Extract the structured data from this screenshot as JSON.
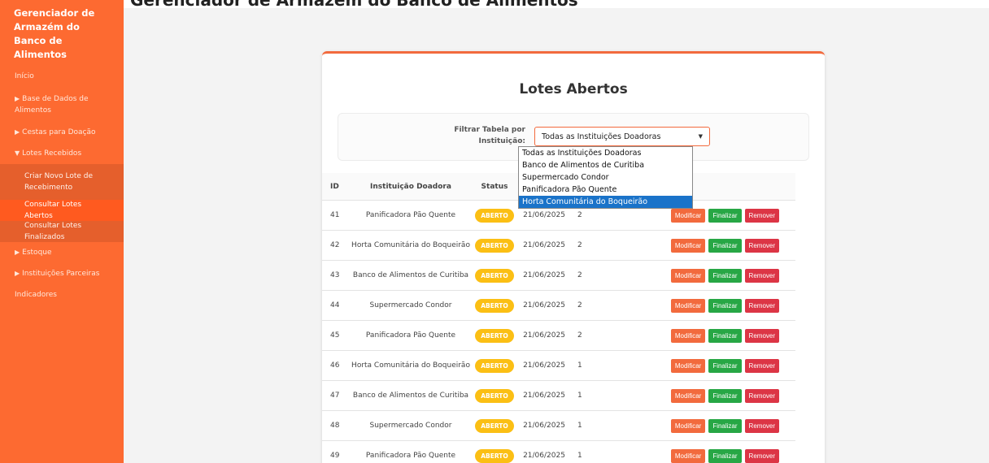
{
  "header": {
    "title": "Gerenciador de Armazém do Banco de Alimentos"
  },
  "sidebar": {
    "brand": "Gerenciador de Armazém do Banco de Alimentos",
    "items": [
      {
        "label": "Início"
      },
      {
        "label": "Base de Dados de Alimentos",
        "arrow": "▶"
      },
      {
        "label": "Cestas para Doação",
        "arrow": "▶"
      },
      {
        "label": "Lotes Recebidos",
        "arrow": "▼"
      }
    ],
    "sub_items": [
      {
        "label": "Criar Novo Lote de Recebimento"
      },
      {
        "label": "Consultar Lotes Abertos"
      },
      {
        "label": "Consultar Lotes Finalizados"
      }
    ],
    "items_after": [
      {
        "label": "Estoque",
        "arrow": "▶"
      },
      {
        "label": "Instituições Parceiras",
        "arrow": "▶"
      },
      {
        "label": "Indicadores"
      }
    ]
  },
  "main": {
    "title": "Lotes Abertos",
    "filter": {
      "label": "Filtrar Tabela por Instituição:",
      "selected": "Todas as Instituições Doadoras",
      "options": [
        "Todas as Instituições Doadoras",
        "Banco de Alimentos de Curitiba",
        "Supermercado Condor",
        "Panificadora Pão Quente",
        "Horta Comunitária do Boqueirão"
      ]
    },
    "table": {
      "headers": [
        "ID",
        "Instituição Doadora",
        "Status"
      ],
      "rows": [
        {
          "id": "41",
          "inst": "Panificadora Pão Quente",
          "status": "ABERTO",
          "date": "21/06/2025",
          "qty": "2"
        },
        {
          "id": "42",
          "inst": "Horta Comunitária do Boqueirão",
          "status": "ABERTO",
          "date": "21/06/2025",
          "qty": "2"
        },
        {
          "id": "43",
          "inst": "Banco de Alimentos de Curitiba",
          "status": "ABERTO",
          "date": "21/06/2025",
          "qty": "2"
        },
        {
          "id": "44",
          "inst": "Supermercado Condor",
          "status": "ABERTO",
          "date": "21/06/2025",
          "qty": "2"
        },
        {
          "id": "45",
          "inst": "Panificadora Pão Quente",
          "status": "ABERTO",
          "date": "21/06/2025",
          "qty": "2"
        },
        {
          "id": "46",
          "inst": "Horta Comunitária do Boqueirão",
          "status": "ABERTO",
          "date": "21/06/2025",
          "qty": "1"
        },
        {
          "id": "47",
          "inst": "Banco de Alimentos de Curitiba",
          "status": "ABERTO",
          "date": "21/06/2025",
          "qty": "1"
        },
        {
          "id": "48",
          "inst": "Supermercado Condor",
          "status": "ABERTO",
          "date": "21/06/2025",
          "qty": "1"
        },
        {
          "id": "49",
          "inst": "Panificadora Pão Quente",
          "status": "ABERTO",
          "date": "21/06/2025",
          "qty": "1"
        }
      ],
      "actions": {
        "modify": "Modificar",
        "finalize": "Finalizar",
        "remove": "Remover"
      }
    }
  },
  "colors": {
    "accent": "#fd6a31",
    "badge": "#fbbf14",
    "finalize": "#27a745",
    "remove": "#dc3545",
    "highlight": "#1a73c9"
  }
}
